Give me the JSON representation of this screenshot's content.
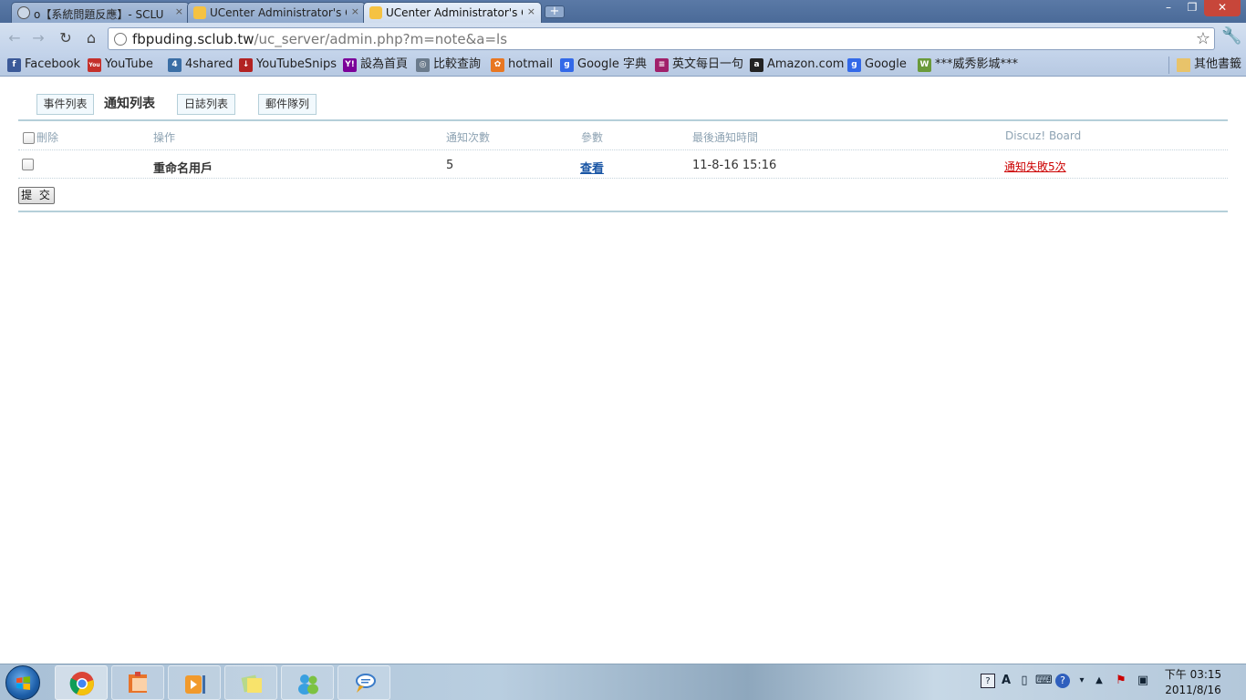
{
  "browser": {
    "tabs": [
      {
        "title": "o【系統問題反應】- SCLU",
        "close": "×"
      },
      {
        "title": "UCenter Administrator's C",
        "close": "×"
      },
      {
        "title": "UCenter Administrator's C",
        "close": "×"
      }
    ],
    "new_tab": "+",
    "window_controls": {
      "minimize": "–",
      "restore": "❐",
      "close": "✕"
    },
    "nav": {
      "back": "←",
      "forward": "→",
      "reload": "↻",
      "home": "⌂"
    },
    "url_host": "fbpuding.sclub.tw",
    "url_path": "/uc_server/admin.php?m=note&a=ls",
    "bookmarks": [
      {
        "label": "Facebook",
        "icon": "facebook-icon",
        "color": "#3b5998",
        "glyph": "f"
      },
      {
        "label": "YouTube",
        "icon": "youtube-icon",
        "color": "#c4302b",
        "glyph": "You"
      },
      {
        "label": "4shared",
        "icon": "4shared-icon",
        "color": "#3a6ea5",
        "glyph": "4"
      },
      {
        "label": "YouTubeSnips",
        "icon": "download-icon",
        "color": "#b22222",
        "glyph": "↓"
      },
      {
        "label": "設為首頁",
        "icon": "yahoo-icon",
        "color": "#7b0099",
        "glyph": "Y!"
      },
      {
        "label": "比較查詢",
        "icon": "globe-icon",
        "color": "#6b7b8c",
        "glyph": "◎"
      },
      {
        "label": "hotmail",
        "icon": "msn-icon",
        "color": "#e87722",
        "glyph": "✿"
      },
      {
        "label": "Google 字典",
        "icon": "google-icon",
        "color": "#3369e8",
        "glyph": "g"
      },
      {
        "label": "英文每日一句",
        "icon": "book-icon",
        "color": "#a0206a",
        "glyph": "≡"
      },
      {
        "label": "Amazon.com",
        "icon": "amazon-icon",
        "color": "#222222",
        "glyph": "a"
      },
      {
        "label": "Google",
        "icon": "google-icon",
        "color": "#3369e8",
        "glyph": "g"
      },
      {
        "label": "***威秀影城***",
        "icon": "vieshow-icon",
        "color": "#6a9a3a",
        "glyph": "W"
      }
    ],
    "other_bookmarks": "其他書籤"
  },
  "subnav": {
    "tab_events": "事件列表",
    "tab_notes": "通知列表",
    "tab_logs": "日誌列表",
    "tab_mail": "郵件隊列"
  },
  "table": {
    "headers": {
      "delete": "刪除",
      "operation": "操作",
      "count": "通知次數",
      "params": "參數",
      "last_time": "最後通知時間",
      "app": "Discuz! Board"
    },
    "rows": [
      {
        "operation": "重命名用戶",
        "count": "5",
        "params": "查看",
        "last_time": "11-8-16 15:16",
        "status": "通知失敗5次"
      }
    ],
    "submit": "提 交"
  },
  "taskbar": {
    "clock_time": "下午 03:15",
    "clock_date": "2011/8/16",
    "apps": [
      "chrome-icon",
      "office-icon",
      "media-player-icon",
      "sticky-notes-icon",
      "messenger-icon",
      "skype-chat-icon"
    ]
  }
}
